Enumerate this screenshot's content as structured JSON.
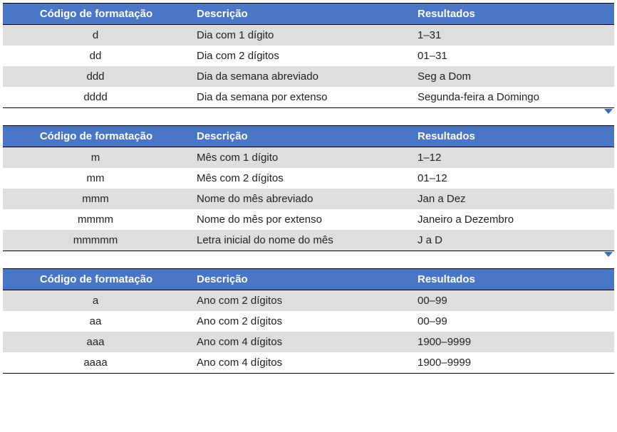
{
  "tables": [
    {
      "headers": {
        "code": "Código de formatação",
        "desc": "Descrição",
        "res": "Resultados"
      },
      "rows": [
        {
          "code": "d",
          "desc": "Dia com 1 dígito",
          "res": "1–31"
        },
        {
          "code": "dd",
          "desc": "Dia com 2 dígitos",
          "res": "01–31"
        },
        {
          "code": "ddd",
          "desc": "Dia da semana abreviado",
          "res": "Seg a Dom"
        },
        {
          "code": "dddd",
          "desc": "Dia da semana por extenso",
          "res": "Segunda-feira a Domingo"
        }
      ]
    },
    {
      "headers": {
        "code": "Código de formatação",
        "desc": "Descrição",
        "res": "Resultados"
      },
      "rows": [
        {
          "code": "m",
          "desc": "Mês com 1 dígito",
          "res": "1–12"
        },
        {
          "code": "mm",
          "desc": "Mês com 2 dígitos",
          "res": "01–12"
        },
        {
          "code": "mmm",
          "desc": "Nome do mês abreviado",
          "res": "Jan a Dez"
        },
        {
          "code": "mmmm",
          "desc": "Nome do mês por extenso",
          "res": "Janeiro a Dezembro"
        },
        {
          "code": "mmmmm",
          "desc": "Letra inicial do nome do mês",
          "res": "J a D"
        }
      ]
    },
    {
      "headers": {
        "code": "Código de formatação",
        "desc": "Descrição",
        "res": "Resultados"
      },
      "rows": [
        {
          "code": "a",
          "desc": "Ano com 2 dígitos",
          "res": "00–99"
        },
        {
          "code": "aa",
          "desc": "Ano com 2 dígitos",
          "res": "00–99"
        },
        {
          "code": "aaa",
          "desc": "Ano com 4 dígitos",
          "res": "1900–9999"
        },
        {
          "code": "aaaa",
          "desc": "Ano com 4 dígitos",
          "res": "1900–9999"
        }
      ]
    }
  ]
}
